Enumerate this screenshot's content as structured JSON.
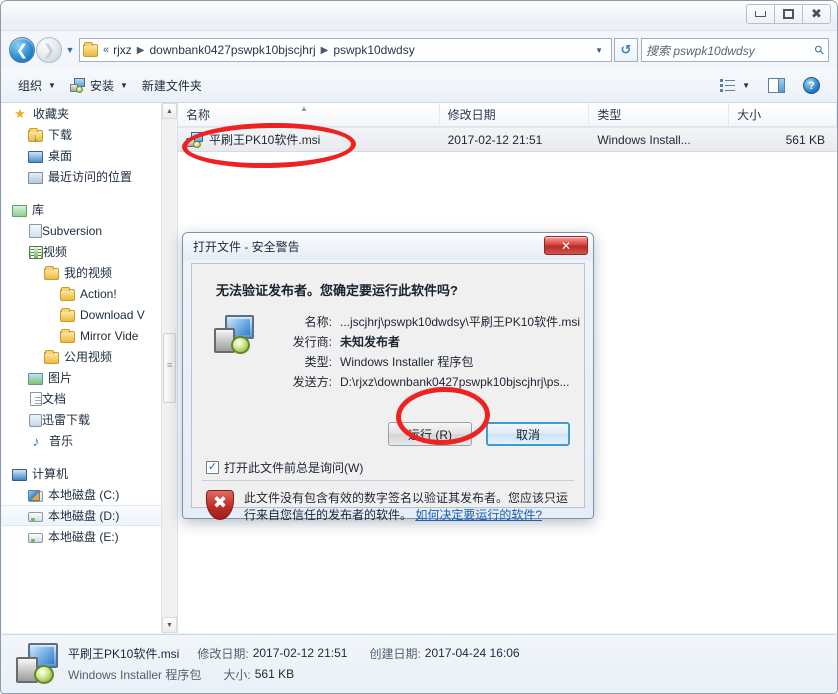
{
  "window": {
    "title": "",
    "controls": {
      "minimize": "minimize-icon",
      "maximize": "maximize-icon",
      "close": "close-icon"
    }
  },
  "nav": {
    "back": "back-icon",
    "forward": "forward-icon",
    "history_caret": "▼",
    "chevrons": "«",
    "breadcrumbs": [
      "rjxz",
      "downbank0427pswpk10bjscjhrj",
      "pswpk10dwdsy"
    ],
    "separator": "▶",
    "address_caret": "▼",
    "refresh": "refresh-icon",
    "search_prefix": "搜索 ",
    "search_placeholder": "搜索 pswpk10dwdsy",
    "search_term": "pswpk10dwdsy",
    "search_icon": "search-icon"
  },
  "toolbar": {
    "organize": "组织",
    "install": "安装",
    "new_folder": "新建文件夹",
    "caret": "▼",
    "view_icon": "list-view-icon",
    "preview_icon": "preview-pane-icon",
    "help_icon": "?"
  },
  "sidebar": {
    "items": [
      {
        "label": "收藏夹",
        "icon": "star-icon",
        "indent": 0,
        "expander": "",
        "selected": false
      },
      {
        "label": "下载",
        "icon": "download-folder-icon",
        "indent": 1,
        "expander": "",
        "selected": false
      },
      {
        "label": "桌面",
        "icon": "desktop-icon",
        "indent": 1,
        "expander": "",
        "selected": false
      },
      {
        "label": "最近访问的位置",
        "icon": "recent-places-icon",
        "indent": 1,
        "expander": "",
        "selected": false
      },
      {
        "label": "库",
        "icon": "library-icon",
        "indent": 0,
        "expander": "",
        "selected": false
      },
      {
        "label": "Subversion",
        "icon": "subversion-icon",
        "indent": 1,
        "expander": "",
        "selected": false
      },
      {
        "label": "视频",
        "icon": "video-library-icon",
        "indent": 1,
        "expander": "",
        "selected": false
      },
      {
        "label": "我的视频",
        "icon": "my-video-folder-icon",
        "indent": 2,
        "expander": "",
        "selected": false
      },
      {
        "label": "Action!",
        "icon": "folder-icon",
        "indent": 3,
        "expander": "",
        "selected": false
      },
      {
        "label": "Download V",
        "icon": "folder-icon",
        "indent": 3,
        "expander": "",
        "selected": false
      },
      {
        "label": "Mirror Vide",
        "icon": "folder-icon",
        "indent": 3,
        "expander": "",
        "selected": false
      },
      {
        "label": "公用视频",
        "icon": "folder-icon",
        "indent": 2,
        "expander": "",
        "selected": false
      },
      {
        "label": "图片",
        "icon": "pictures-icon",
        "indent": 1,
        "expander": "",
        "selected": false
      },
      {
        "label": "文档",
        "icon": "documents-icon",
        "indent": 1,
        "expander": "",
        "selected": false
      },
      {
        "label": "迅雷下载",
        "icon": "xunlei-download-icon",
        "indent": 1,
        "expander": "",
        "selected": false
      },
      {
        "label": "音乐",
        "icon": "music-icon",
        "indent": 1,
        "expander": "",
        "selected": false
      },
      {
        "label": "计算机",
        "icon": "computer-icon",
        "indent": 0,
        "expander": "",
        "selected": false
      },
      {
        "label": "本地磁盘 (C:)",
        "icon": "system-drive-icon",
        "indent": 1,
        "expander": "",
        "selected": false
      },
      {
        "label": "本地磁盘 (D:)",
        "icon": "drive-icon",
        "indent": 1,
        "expander": "",
        "selected": true
      },
      {
        "label": "本地磁盘 (E:)",
        "icon": "drive-icon",
        "indent": 1,
        "expander": "",
        "selected": false
      }
    ],
    "scroll_up": "▲",
    "scroll_down": "▼"
  },
  "filelist": {
    "columns": [
      "名称",
      "修改日期",
      "类型",
      "大小"
    ],
    "sort_caret": "▲",
    "rows": [
      {
        "name": "平刷王PK10软件.msi",
        "date": "2017-02-12 21:51",
        "type": "Windows Install...",
        "size": "561 KB",
        "icon": "msi-installer-icon",
        "selected": true
      }
    ]
  },
  "statusbar": {
    "file_name": "平刷王PK10软件.msi",
    "modified_label": "修改日期:",
    "modified_value": "2017-02-12 21:51",
    "created_label": "创建日期:",
    "created_value": "2017-04-24 16:06",
    "file_type": "Windows Installer 程序包",
    "size_label": "大小:",
    "size_value": "561 KB",
    "icon": "msi-installer-icon"
  },
  "dialog": {
    "title": "打开文件 - 安全警告",
    "close_label": "✕",
    "heading": "无法验证发布者。您确定要运行此软件吗?",
    "file_icon": "msi-installer-icon",
    "fields": [
      {
        "label": "名称:",
        "value": "...jscjhrj\\pswpk10dwdsy\\平刷王PK10软件.msi",
        "bold": false
      },
      {
        "label": "发行商:",
        "value": "未知发布者",
        "bold": true
      },
      {
        "label": "类型:",
        "value": "Windows Installer 程序包",
        "bold": false
      },
      {
        "label": "发送方:",
        "value": "D:\\rjxz\\downbank0427pswpk10bjscjhrj\\ps...",
        "bold": false
      }
    ],
    "run_button": "运行 (R)",
    "cancel_button": "取消",
    "checkbox_checked": "✓",
    "checkbox_label": "打开此文件前总是询问(W)",
    "footer_icon": "red-shield-warning-icon",
    "footer_text": "此文件没有包含有效的数字签名以验证其发布者。您应该只运行来自您信任的发布者的软件。",
    "footer_link": "如何决定要运行的软件?"
  },
  "annotations": {
    "file_ellipse": "red-ellipse-around-file",
    "run_ellipse": "red-ellipse-around-run-button"
  },
  "colors": {
    "accent_blue": "#2f7fd0",
    "annotation_red": "#ee2222",
    "dialog_close_red": "#c2312a",
    "link_blue": "#1a5fb4"
  }
}
